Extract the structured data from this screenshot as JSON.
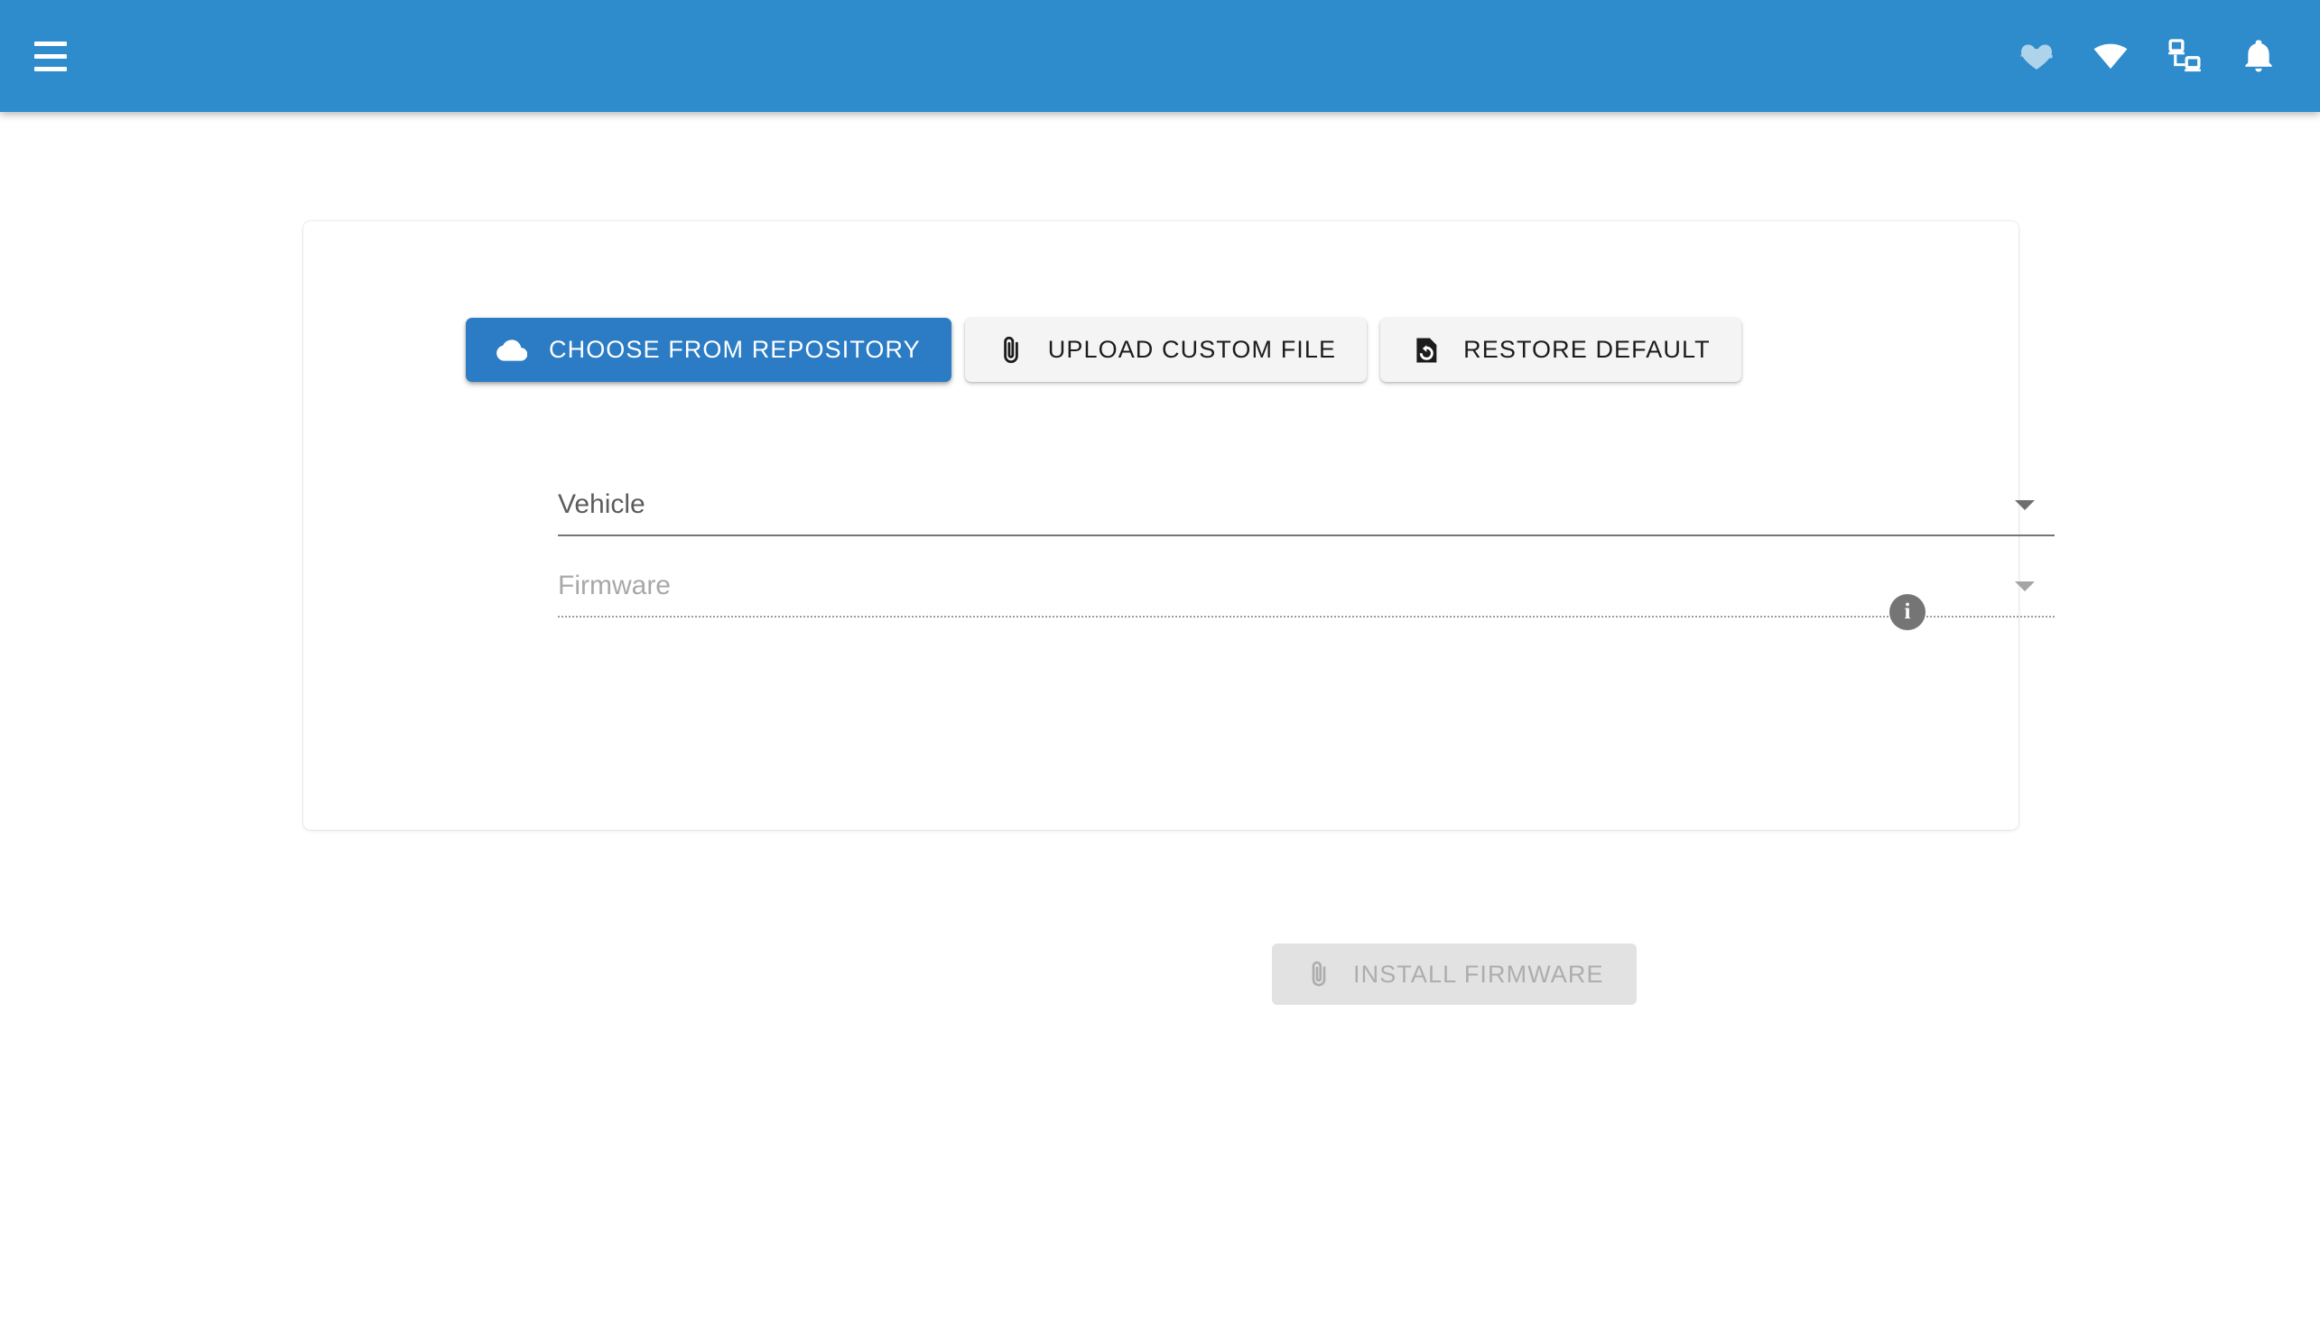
{
  "appbar": {
    "menu_label": "menu",
    "background_color": "#2e8bcc",
    "icons": [
      {
        "name": "heartbeat-icon",
        "label": "System health"
      },
      {
        "name": "wifi-icon",
        "label": "Wi-Fi"
      },
      {
        "name": "devices-icon",
        "label": "Connected devices"
      },
      {
        "name": "bell-icon",
        "label": "Notifications"
      }
    ]
  },
  "card": {
    "source_tabs": [
      {
        "id": "repository",
        "label": "CHOOSE FROM REPOSITORY",
        "icon": "cloud-icon",
        "active": true
      },
      {
        "id": "upload",
        "label": "UPLOAD CUSTOM FILE",
        "icon": "paperclip-icon",
        "active": false
      },
      {
        "id": "restore",
        "label": "RESTORE DEFAULT",
        "icon": "file-restore-icon",
        "active": false
      }
    ],
    "fields": {
      "vehicle": {
        "label": "Vehicle",
        "value": "",
        "placeholder": "Vehicle",
        "disabled": false
      },
      "firmware": {
        "label": "Firmware",
        "value": "",
        "placeholder": "Firmware",
        "disabled": true
      }
    },
    "info_badge": {
      "glyph": "i",
      "name": "firmware-info-icon"
    },
    "install_button": {
      "label": "INSTALL FIRMWARE",
      "icon": "paperclip-icon",
      "disabled": true
    }
  },
  "colors": {
    "accent_blue": "#2b7cc4",
    "appbar_blue": "#2e8bcc",
    "disabled_gray": "#e2e2e2",
    "disabled_text": "#adadad",
    "page_background": "#ffffff"
  }
}
